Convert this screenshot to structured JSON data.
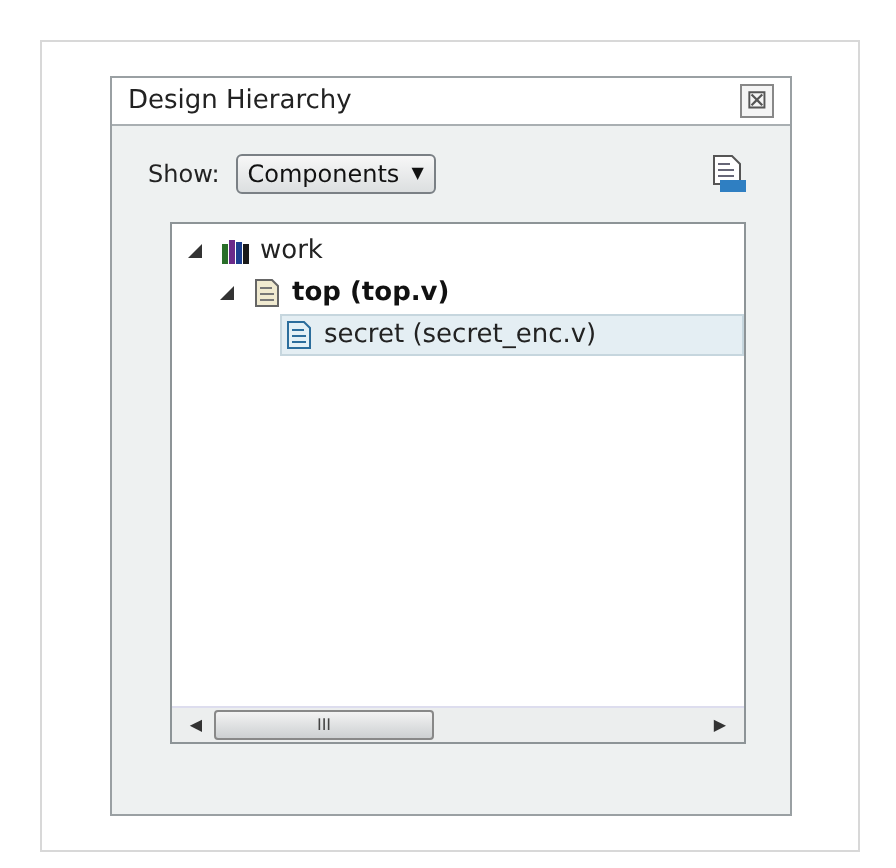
{
  "window": {
    "title": "Design Hierarchy",
    "close_glyph": "⊠"
  },
  "toolbar": {
    "show_label": "Show:",
    "dropdown": {
      "value": "Components",
      "caret": "▼"
    }
  },
  "tree": [
    {
      "label": "work",
      "kind": "library",
      "expanded": true,
      "selected": false,
      "children": [
        {
          "label": "top (top.v)",
          "kind": "top_module",
          "expanded": true,
          "selected": false,
          "children": [
            {
              "label": "secret (secret_enc.v)",
              "kind": "module",
              "selected": true
            }
          ]
        }
      ]
    }
  ],
  "scrollbar": {
    "left": "◀",
    "grip": "III",
    "right": "▶"
  }
}
